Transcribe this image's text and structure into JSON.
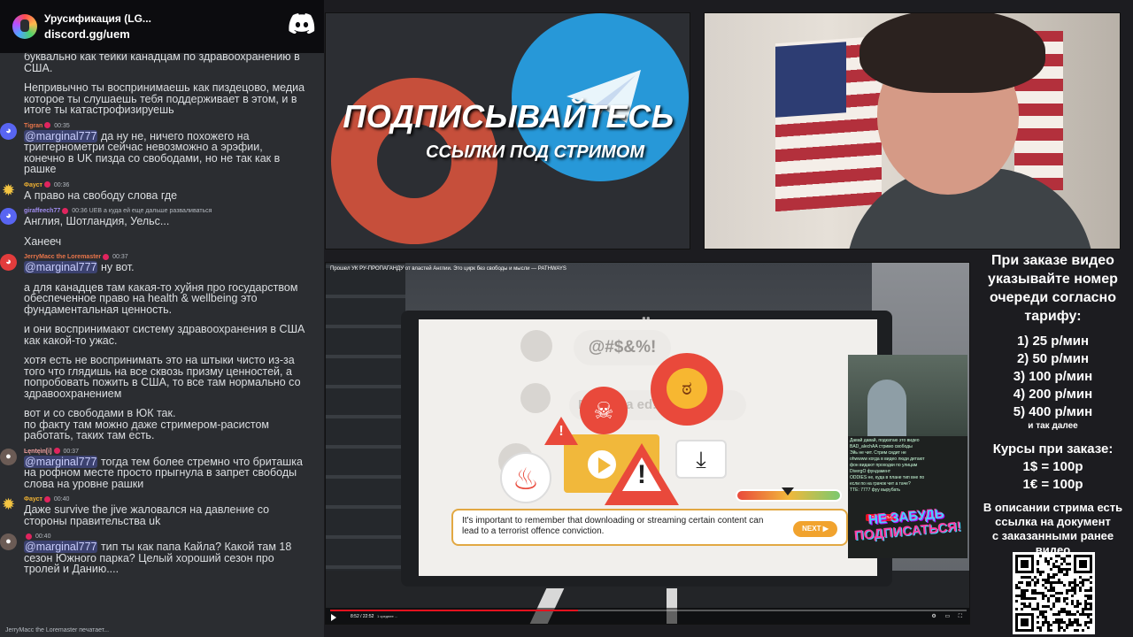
{
  "discord": {
    "server_name": "Урусификация (LG...",
    "invite": "discord.gg/uem",
    "logo_icon": "discord-logo-icon"
  },
  "chat": {
    "messages": [
      {
        "author": "",
        "time": "",
        "lines": [
          "буквально как тейки канадцам по здравоохранению в",
          "США.",
          "",
          "Непривычно ты воспринимаешь как пиздецово, медиа",
          "которое ты слушаешь тебя поддерживает в этом, и в",
          "итоге ты катастрофизируешь"
        ],
        "avatar": "none"
      },
      {
        "author": "Tigran",
        "time": "00:35",
        "mention": "@marginal777",
        "lines": [
          "да ну не, ничего похожего на",
          "триггернометри сейчас невозможно а эрэфии,",
          "конечно в UK пизда со свободами, но не так как в",
          "рашке"
        ],
        "avatar": "discord"
      },
      {
        "author": "Фауст",
        "time": "00:36",
        "lines": [
          "А право на свободу слова где"
        ],
        "avatar": "sun"
      },
      {
        "author": "giraffeech77",
        "time": "00:36",
        "reply": "UEB а куда ей еще дальше разваливаться",
        "lines": [
          "Англия, Шотландия, Уельс...",
          "",
          "Ханееч"
        ],
        "avatar": "discord"
      },
      {
        "author": "JerryMacc the Loremaster",
        "time": "00:37",
        "mention": "@marginal777",
        "lines": [
          "ну вот.",
          "",
          "а для канадцев там какая-то хуйня про государством",
          "обеспеченное право на health & wellbeing это",
          "фундаментальная ценность.",
          "",
          "и они воспринимают систему здравоохранения в США",
          "как какой-то ужас.",
          "",
          "хотя есть не воспринимать это на штыки чисто из-за",
          "того что глядишь на все сквозь призму ценностей, а",
          "попробовать пожить в США, то все там нормально со",
          "здравоохранением",
          "",
          "вот и со свободами в ЮК так.",
          "по факту там можно даже стримером-расистом",
          "работать, таких там есть."
        ],
        "avatar": "red"
      },
      {
        "author": "Ŀęntęìn[i]",
        "time": "00:37",
        "mention": "@marginal777",
        "lines": [
          "тогда тем более стремно что бриташка",
          "на рофном месте просто прыгнула в запрет свободы",
          "слова на уровне рашки"
        ],
        "avatar": "photo"
      },
      {
        "author": "Фауст",
        "time": "00:40",
        "lines": [
          "Даже survive the jive жаловался на давление со",
          "стороны правительства uk"
        ],
        "avatar": "sun"
      },
      {
        "author": "",
        "time": "00:40",
        "mention": "@marginal777",
        "lines": [
          "тип ты как папа Кайла? Какой там 18",
          "сезон Южного парка? Целый хороший сезон про",
          "тролей и Данию...."
        ],
        "avatar": "photo"
      }
    ],
    "typing": "JerryMacc the Loremaster печатает..."
  },
  "promo": {
    "line1": "ПОДПИСЫВАЙТЕСЬ",
    "line2": "ССЫЛКИ ПОД СТРИМОМ",
    "icons": [
      "patreon-logo-icon",
      "telegram-logo-icon"
    ]
  },
  "video": {
    "title": "Прошел УК РУ-ПРОПАГАНДУ от властей Англии. Это цирк без свободы и мысли — PATHWAYS",
    "screen_symbols": "@#$&%!",
    "screen_download": "Downloa       ed!",
    "notice": "It's important to remember that downloading or streaming certain content can lead to a terrorist offence conviction.",
    "next_label": "NEXT ▶",
    "timecode": "8:52 / 22:52",
    "chapter": "1 среднее ...",
    "progress": 0.39,
    "pip_chat": [
      "Давай давай, подкатаю это видео",
      "BAD_alechAA стримо свободы",
      "Эйь не чит. Стрим сидит не",
      "ohwwww когда в видео люди детают",
      "фон видают проходки по улицам",
      "DivergO  фундамент",
      "ODDIES не, куда в плане тип вне по",
      "если по на грачок чит а таче?",
      "TTE: 7777 фуу вырубать"
    ],
    "pip_sub": "Подписаться",
    "sticker_line1": "НЕ ЗАБУДЬ",
    "sticker_line2": "ПОДПИСАТЬСЯ!"
  },
  "info": {
    "header": [
      "При заказе видео",
      "указывайте номер",
      "очереди согласно",
      "тарифу:"
    ],
    "tariffs": [
      "1) 25 р/мин",
      "2) 50 р/мин",
      "3) 100 р/мин",
      "4) 200 р/мин",
      "5) 400 р/мин"
    ],
    "tariff_more": "и так далее",
    "courses_title": "Курсы при заказе:",
    "courses": [
      "1$ = 100р",
      "1€ = 100р"
    ],
    "desc_note": [
      "В описании стрима есть",
      "ссылка на документ",
      "с заказанными ранее",
      "видео"
    ]
  },
  "colors": {
    "chat_bg": "#2b2d31",
    "mention_bg": "#3c4270",
    "discord_blurple": "#5865f2",
    "telegram_blue": "#2798d8",
    "patreon_red": "#e2553d",
    "notice_button": "#f1a32e",
    "progress_red": "#e3121e"
  }
}
